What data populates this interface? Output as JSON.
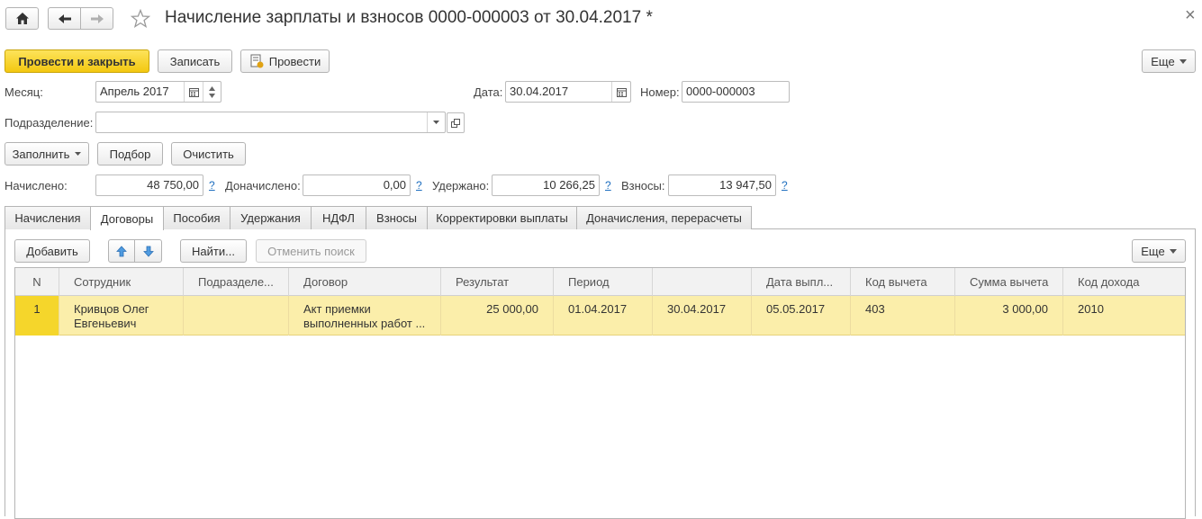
{
  "window": {
    "title": "Начисление зарплаты и взносов 0000-000003 от 30.04.2017 *",
    "close_glyph": "×"
  },
  "nav": {
    "home_icon": "home-icon",
    "back_icon": "arrow-left-icon",
    "forward_icon": "arrow-right-icon",
    "favorite_icon": "star-icon"
  },
  "toolbar": {
    "post_and_close": "Провести и закрыть",
    "save": "Записать",
    "post": "Провести",
    "more": "Еще"
  },
  "form": {
    "month_label": "Месяц:",
    "month_value": "Апрель 2017",
    "date_label": "Дата:",
    "date_value": "30.04.2017",
    "number_label": "Номер:",
    "number_value": "0000-000003",
    "department_label": "Подразделение:",
    "department_value": "",
    "fill_button": "Заполнить",
    "select_button": "Подбор",
    "clear_button": "Очистить",
    "accrued_label": "Начислено:",
    "accrued_value": "48 750,00",
    "additional_label": "Доначислено:",
    "additional_value": "0,00",
    "withheld_label": "Удержано:",
    "withheld_value": "10 266,25",
    "contributions_label": "Взносы:",
    "contributions_value": "13 947,50",
    "help_mark": "?"
  },
  "tabs": [
    {
      "label": "Начисления"
    },
    {
      "label": "Договоры"
    },
    {
      "label": "Пособия"
    },
    {
      "label": "Удержания"
    },
    {
      "label": "НДФЛ"
    },
    {
      "label": "Взносы"
    },
    {
      "label": "Корректировки выплаты"
    },
    {
      "label": "Доначисления, перерасчеты"
    }
  ],
  "active_tab": "Договоры",
  "table_toolbar": {
    "add": "Добавить",
    "find": "Найти...",
    "cancel_search": "Отменить поиск",
    "more": "Еще"
  },
  "table": {
    "columns": [
      "N",
      "Сотрудник",
      "Подразделе...",
      "Договор",
      "Результат",
      "Период",
      "",
      "Дата выпл...",
      "Код вычета",
      "Сумма вычета",
      "Код дохода"
    ],
    "rows": [
      {
        "n": "1",
        "employee_line1": "Кривцов Олег",
        "employee_line2": "Евгеньевич",
        "department": "",
        "contract_line1": "Акт приемки",
        "contract_line2": "выполненных работ ...",
        "result": "25 000,00",
        "period_start": "01.04.2017",
        "period_end": "30.04.2017",
        "payment_date": "05.05.2017",
        "deduction_code": "403",
        "deduction_sum": "3 000,00",
        "income_code": "2010"
      }
    ]
  },
  "colors": {
    "primary_button": "#f3c811",
    "selected_row": "#fbeeaa",
    "selected_num_cell": "#f5d62b",
    "link": "#1f6fbf"
  }
}
